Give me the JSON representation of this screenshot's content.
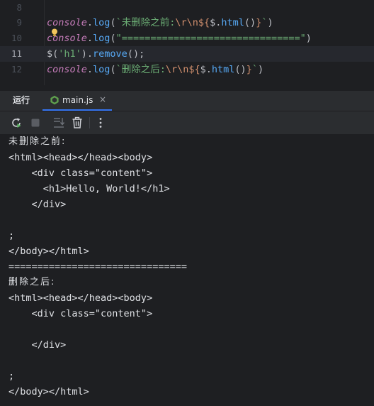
{
  "editor": {
    "lines": [
      {
        "number": "8",
        "segments": []
      },
      {
        "number": "9",
        "segments": [
          {
            "text": "console",
            "cls": "t-obj"
          },
          {
            "text": ".",
            "cls": "t-def"
          },
          {
            "text": "log",
            "cls": "t-fn"
          },
          {
            "text": "(",
            "cls": "t-def"
          },
          {
            "text": "`未删除之前:",
            "cls": "t-str"
          },
          {
            "text": "\\r\\n",
            "cls": "t-esc"
          },
          {
            "text": "${",
            "cls": "t-esc"
          },
          {
            "text": "$",
            "cls": "t-def"
          },
          {
            "text": ".",
            "cls": "t-def"
          },
          {
            "text": "html",
            "cls": "t-html"
          },
          {
            "text": "()",
            "cls": "t-def"
          },
          {
            "text": "}",
            "cls": "t-esc"
          },
          {
            "text": "`",
            "cls": "t-str"
          },
          {
            "text": ")",
            "cls": "t-def"
          }
        ]
      },
      {
        "number": "10",
        "segments": [
          {
            "text": "console",
            "cls": "t-obj"
          },
          {
            "text": ".",
            "cls": "t-def"
          },
          {
            "text": "log",
            "cls": "t-fn"
          },
          {
            "text": "(",
            "cls": "t-def"
          },
          {
            "text": "\"===============================\"",
            "cls": "t-str"
          },
          {
            "text": ")",
            "cls": "t-def"
          }
        ]
      },
      {
        "number": "11",
        "current": true,
        "segments": [
          {
            "text": "$(",
            "cls": "t-def"
          },
          {
            "text": "'h1'",
            "cls": "t-str"
          },
          {
            "text": ").",
            "cls": "t-def"
          },
          {
            "text": "remove",
            "cls": "t-fn"
          },
          {
            "text": "();",
            "cls": "t-def"
          }
        ]
      },
      {
        "number": "12",
        "segments": [
          {
            "text": "console",
            "cls": "t-obj"
          },
          {
            "text": ".",
            "cls": "t-def"
          },
          {
            "text": "log",
            "cls": "t-fn"
          },
          {
            "text": "(",
            "cls": "t-def"
          },
          {
            "text": "`删除之后:",
            "cls": "t-str"
          },
          {
            "text": "\\r\\n",
            "cls": "t-esc"
          },
          {
            "text": "${",
            "cls": "t-esc"
          },
          {
            "text": "$",
            "cls": "t-def"
          },
          {
            "text": ".",
            "cls": "t-def"
          },
          {
            "text": "html",
            "cls": "t-html"
          },
          {
            "text": "()",
            "cls": "t-def"
          },
          {
            "text": "}",
            "cls": "t-esc"
          },
          {
            "text": "`",
            "cls": "t-str"
          },
          {
            "text": ")",
            "cls": "t-def"
          }
        ]
      }
    ]
  },
  "tool_window": {
    "title": "运行",
    "tab": {
      "label": "main.js",
      "close": "×",
      "icon": "nodejs-icon"
    },
    "toolbar": [
      {
        "name": "rerun-icon"
      },
      {
        "name": "stop-icon"
      },
      {
        "name": "scroll-to-end-icon"
      },
      {
        "name": "trash-icon"
      },
      {
        "name": "more-icon"
      }
    ],
    "accent": "#3574f0"
  },
  "console": {
    "lines": [
      {
        "text": "未删除之前:",
        "cjk": true
      },
      {
        "text": "<html><head></head><body>"
      },
      {
        "text": "    <div class=\"content\">"
      },
      {
        "text": "      <h1>Hello, World!</h1>"
      },
      {
        "text": "    </div>"
      },
      {
        "text": ""
      },
      {
        "text": ";"
      },
      {
        "text": "</body></html>"
      },
      {
        "text": "==============================="
      },
      {
        "text": "删除之后:",
        "cjk": true
      },
      {
        "text": "<html><head></head><body>"
      },
      {
        "text": "    <div class=\"content\">"
      },
      {
        "text": ""
      },
      {
        "text": "    </div>"
      },
      {
        "text": ""
      },
      {
        "text": ";"
      },
      {
        "text": "</body></html>"
      }
    ]
  }
}
